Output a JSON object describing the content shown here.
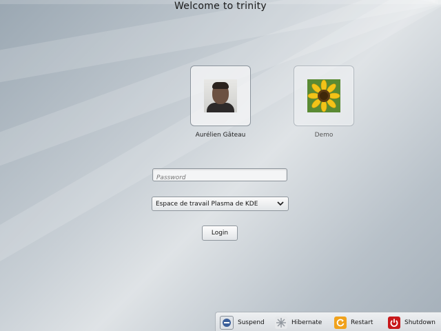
{
  "greeting": "Welcome to trinity",
  "users": [
    {
      "name": "Aurélien Gâteau",
      "avatar_icon": "user-photo-icon"
    },
    {
      "name": "Demo",
      "avatar_icon": "sunflower-icon"
    }
  ],
  "password": {
    "placeholder": "Password",
    "value": ""
  },
  "session": {
    "selected": "Espace de travail Plasma de KDE"
  },
  "login_label": "Login",
  "actions": [
    {
      "label": "Suspend",
      "icon": "suspend-icon"
    },
    {
      "label": "Hibernate",
      "icon": "hibernate-icon"
    },
    {
      "label": "Restart",
      "icon": "restart-icon"
    },
    {
      "label": "Shutdown",
      "icon": "shutdown-icon"
    }
  ]
}
